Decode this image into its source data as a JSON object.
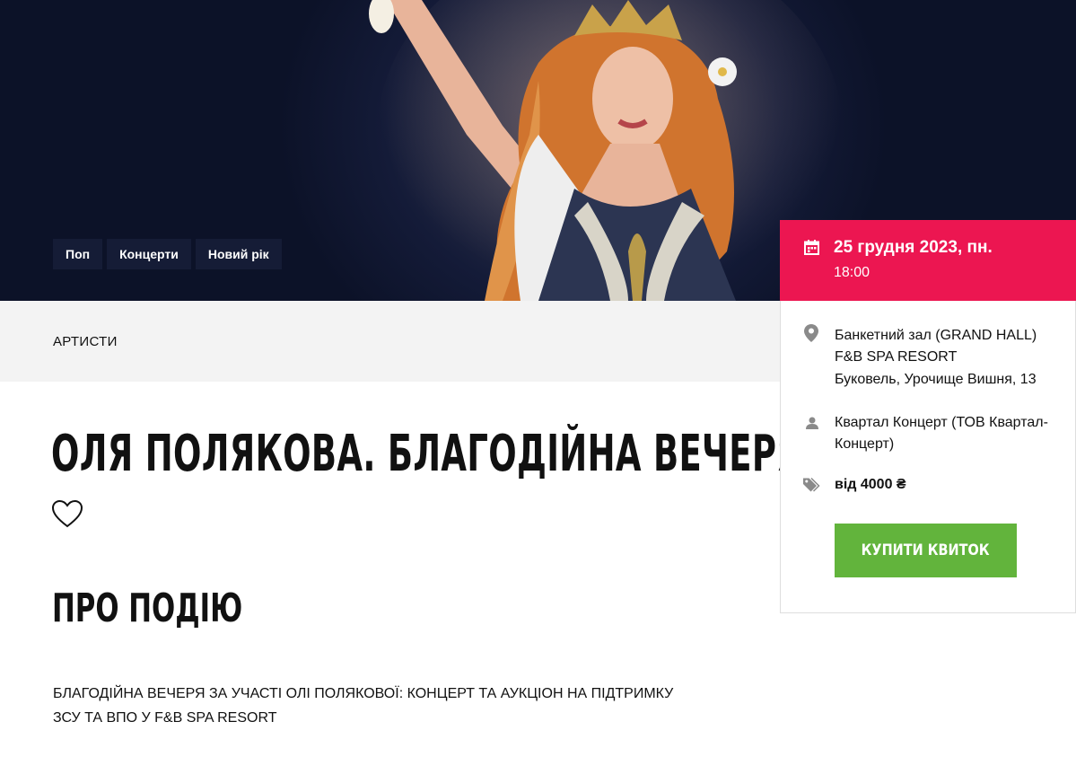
{
  "hero": {
    "tags": [
      "Поп",
      "Концерти",
      "Новий рік"
    ]
  },
  "band": {
    "link": "АРТИСТИ"
  },
  "event": {
    "title": "ОЛЯ ПОЛЯКОВА. БЛАГОДІЙНА ВЕЧЕРЯ",
    "about_heading": "ПРО ПОДІЮ",
    "description": "БЛАГОДІЙНА ВЕЧЕРЯ ЗА УЧАСТІ ОЛІ ПОЛЯКОВОЇ: КОНЦЕРТ ТА АУКЦІОН НА ПІДТРИМКУ ЗСУ ТА ВПО У F&B SPA RESORT"
  },
  "panel": {
    "date": "25 грудня 2023, пн.",
    "time": "18:00",
    "venue": "Банкетний зал (GRAND HALL) F&B SPA RESORT",
    "address": "Буковель, Урочище Вишня, 13",
    "organizer": "Квартал Концерт (ТОВ Квартал-Концерт)",
    "price": "від 4000 ₴",
    "buy_label": "КУПИТИ КВИТОК",
    "accent_color": "#ec1651",
    "button_color": "#62b43c"
  },
  "icons": [
    "calendar-icon",
    "location-pin-icon",
    "person-icon",
    "price-tag-icon",
    "heart-icon"
  ]
}
